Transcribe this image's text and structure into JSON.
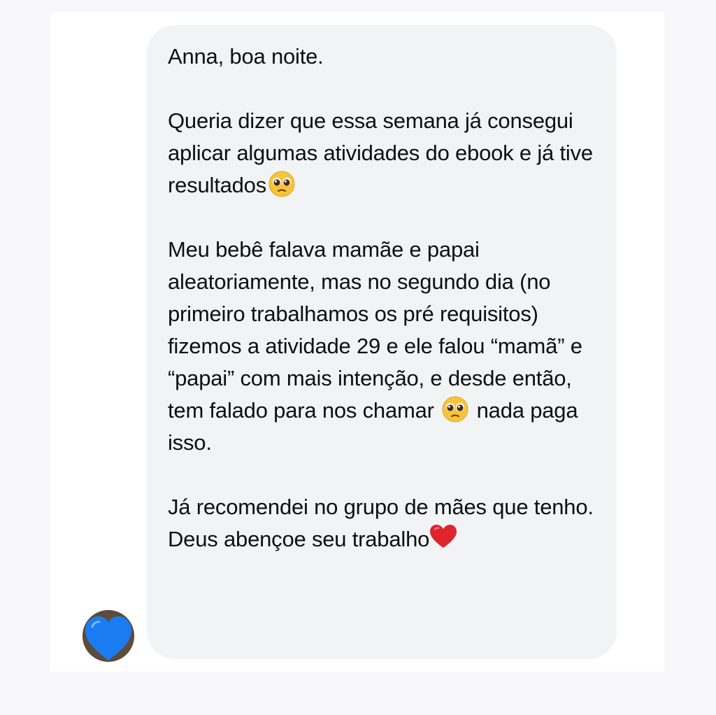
{
  "message": {
    "greeting": "Anna, boa noite.",
    "paragraph_2": "Queria dizer que essa semana já consegui aplicar algumas atividades do ebook e já tive resultados",
    "paragraph_3_part_1": "Meu bebê falava mamãe e papai aleatoriamente, mas no segundo dia (no primeiro trabalhamos os pré requisitos) fizemos a atividade 29 e ele falou “mamã” e “papai” com mais intenção, e desde então, tem falado para nos chamar",
    "paragraph_3_part_2": "nada paga isso.",
    "paragraph_4": "Já recomendei no grupo de mães que tenho. Deus abençoe seu trabalho",
    "emoji_1": "pleading-face-icon",
    "emoji_2": "pleading-face-icon",
    "emoji_3": "red-heart-icon"
  },
  "sender": {
    "avatar_icon": "blue-heart-icon"
  },
  "colors": {
    "bubble_background": "#f2f3f5",
    "text": "#0f0f0f",
    "page_background": "#ffffff",
    "outer_background": "#f8f8fa",
    "heart_red": "#e0242b",
    "heart_blue": "#1b7cf2"
  }
}
